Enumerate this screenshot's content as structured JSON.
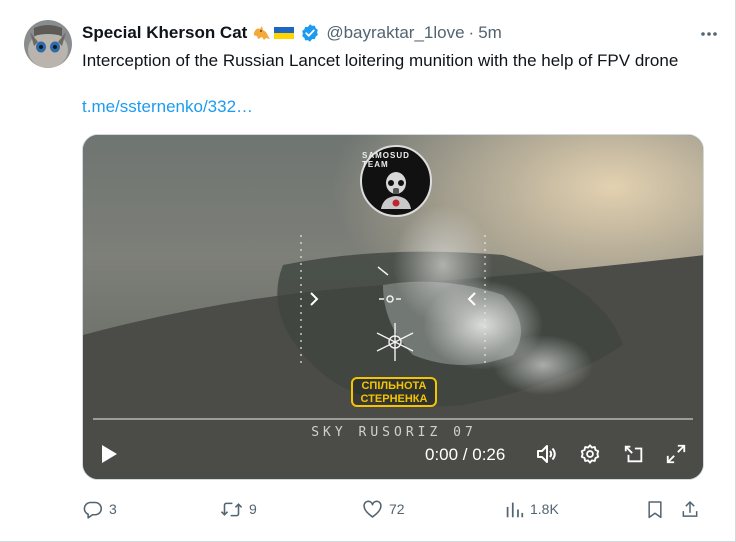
{
  "tweet": {
    "author_name": "Special Kherson Cat",
    "author_emoji": "🐈🇺🇦",
    "handle": "@bayraktar_1love",
    "separator": "·",
    "time": "5m",
    "text": "Interception of the Russian Lancet loitering munition with the help of FPV drone",
    "link": "t.me/ssternenko/332…"
  },
  "media": {
    "badge_top_text": "SAMOSUD TEAM",
    "badge_bottom_line1": "СПІЛЬНОТА",
    "badge_bottom_line2": "СТЕРНЕНКА",
    "watermark": "SKY RUSORIZ 07",
    "timecode": "0:00 / 0:26",
    "progress": 0.0
  },
  "actions": {
    "replies": "3",
    "reposts": "9",
    "likes": "72",
    "views": "1.8K"
  },
  "colors": {
    "accent": "#1d9bf0",
    "muted": "#536471",
    "text": "#0f1419",
    "verified": "#1d9bf0",
    "badge_yellow": "#f5c400"
  }
}
